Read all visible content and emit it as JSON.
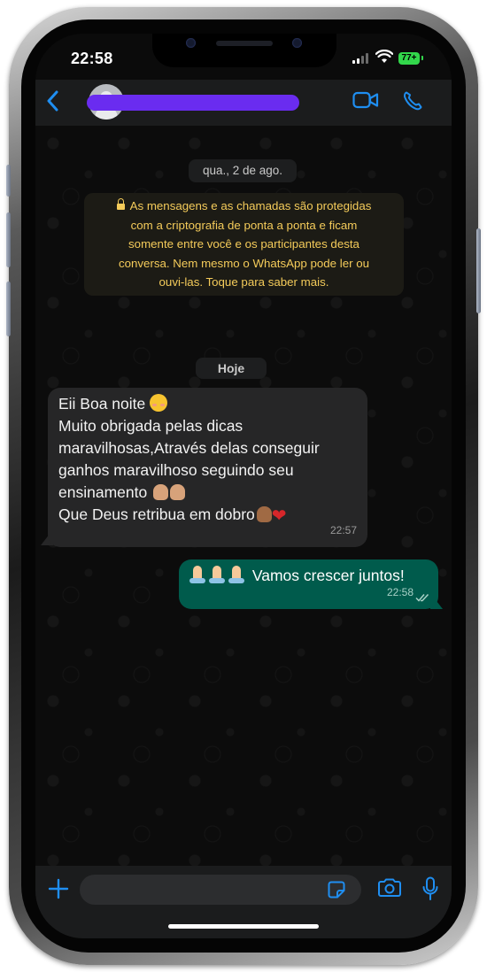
{
  "status_bar": {
    "time": "22:58",
    "battery": "77+"
  },
  "header": {
    "contact_name": "",
    "back_icon": "chevron-left-icon",
    "video_icon": "video-camera-icon",
    "call_icon": "phone-icon",
    "accent": "#1f8ef1"
  },
  "chat": {
    "date_label": "qua., 2 de ago.",
    "encryption_notice": {
      "lines": [
        "As mensagens e as chamadas são protegidas",
        "com a criptografia de ponta a ponta e ficam",
        "somente entre você e os participantes desta",
        "conversa. Nem mesmo o WhatsApp pode ler ou",
        "ouvi-las. Toque para saber mais."
      ],
      "color": "#f4cb5a"
    },
    "today_label": "Hoje",
    "messages": [
      {
        "direction": "incoming",
        "lines": [
          "Eii Boa noite",
          "Muito obrigada pelas dicas",
          "maravilhosas,Através delas conseguir",
          "ganhos maravilhoso seguindo seu",
          "ensinamento",
          "Que Deus retribua em dobro"
        ],
        "emojis": [
          "smiling-face-icon",
          "heart-hands-icon",
          "clapping-hands-icon",
          "raising-hands-icon",
          "red-heart-icon"
        ],
        "time": "22:57"
      },
      {
        "direction": "outgoing",
        "text": "Vamos crescer juntos!",
        "emojis": [
          "folded-hands-icon",
          "folded-hands-icon",
          "folded-hands-icon"
        ],
        "time": "22:58",
        "status": "read"
      }
    ]
  },
  "input_bar": {
    "placeholder": "",
    "plus_icon": "plus-icon",
    "sticker_icon": "sticker-icon",
    "camera_icon": "camera-icon",
    "mic_icon": "microphone-icon"
  },
  "colors": {
    "incoming_bubble": "#262627",
    "outgoing_bubble": "#005b4c",
    "header_bg": "#1b1c1d",
    "chat_bg": "#0c0c0c"
  }
}
